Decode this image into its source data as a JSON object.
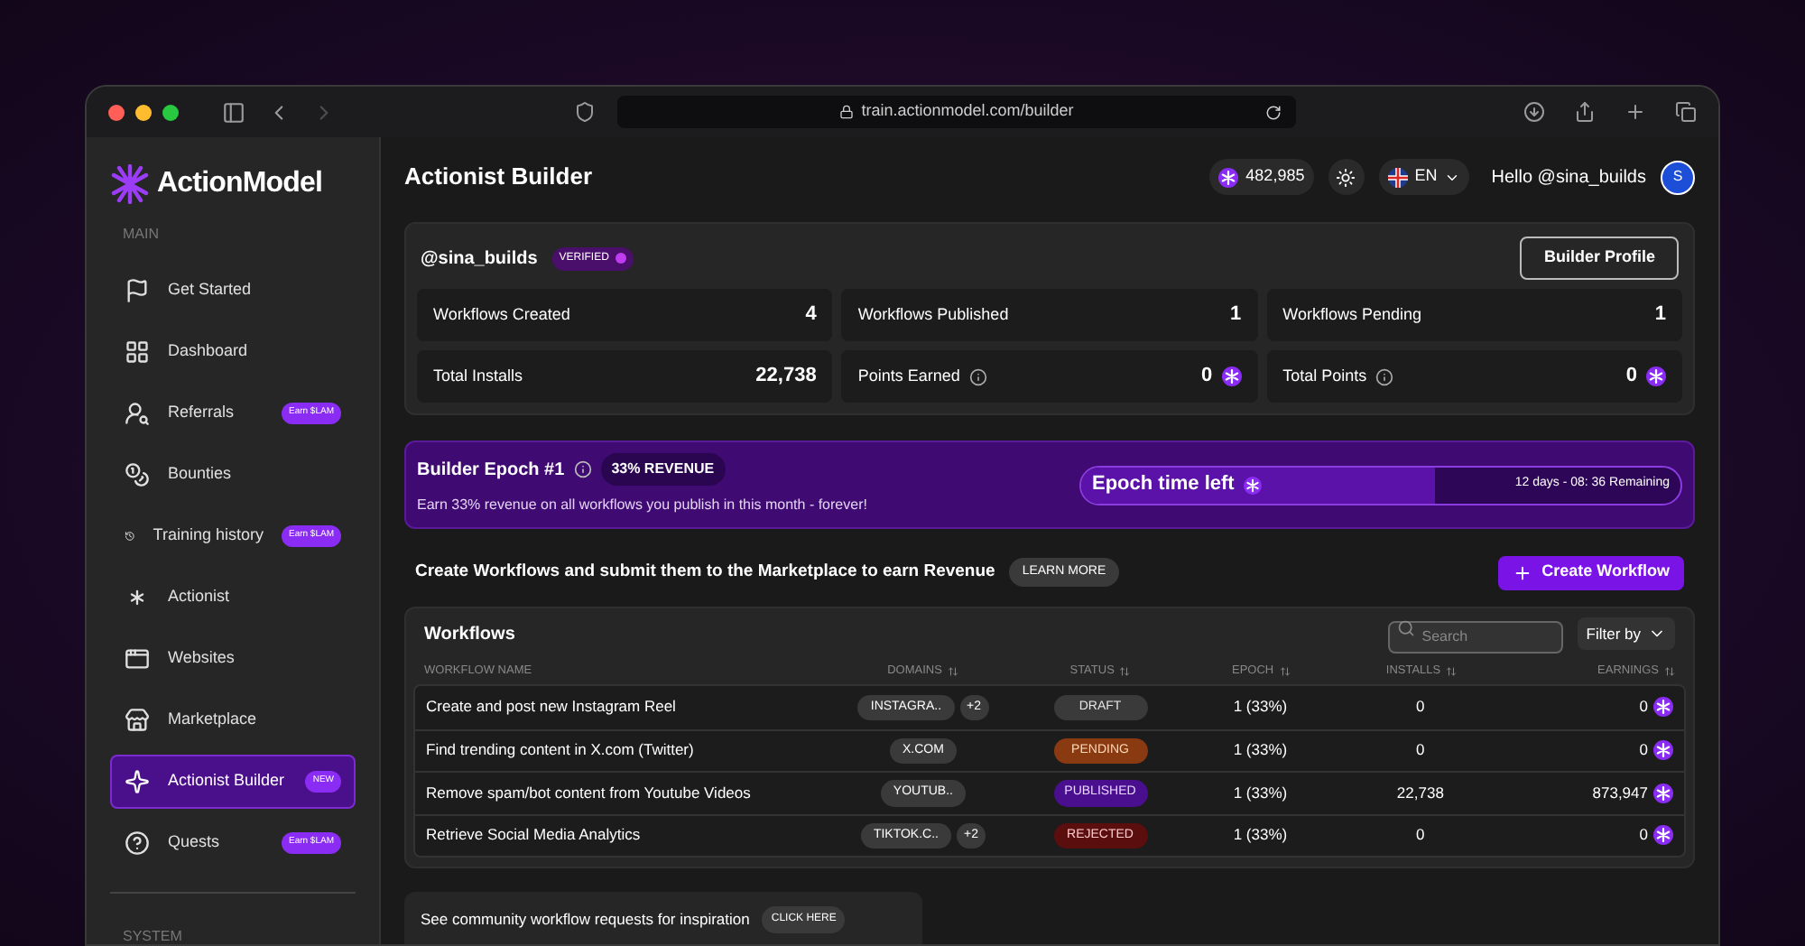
{
  "browser": {
    "url": "train.actionmodel.com/builder"
  },
  "sidebar": {
    "logo": "ActionModel",
    "section_main": "MAIN",
    "section_system": "SYSTEM",
    "items": [
      {
        "label": "Get Started",
        "selected": false
      },
      {
        "label": "Dashboard",
        "selected": false
      },
      {
        "label": "Referrals",
        "selected": false,
        "badge": "Earn $LAM"
      },
      {
        "label": "Bounties",
        "selected": false
      },
      {
        "label": "Training history",
        "selected": false,
        "badge": "Earn $LAM"
      },
      {
        "label": "Actionist",
        "selected": false
      },
      {
        "label": "Websites",
        "selected": false
      },
      {
        "label": "Marketplace",
        "selected": false
      },
      {
        "label": "Actionist Builder",
        "selected": true,
        "badge": "NEW"
      },
      {
        "label": "Quests",
        "selected": false,
        "badge": "Earn $LAM"
      }
    ]
  },
  "header": {
    "title": "Actionist Builder",
    "points": "482,985",
    "language": "EN",
    "greeting": "Hello @sina_builds",
    "avatar": "S"
  },
  "profile": {
    "handle": "@sina_builds",
    "verified_label": "VERIFIED",
    "button": "Builder Profile",
    "stats": [
      {
        "label": "Workflows Created",
        "value": "4",
        "info": false,
        "token": false
      },
      {
        "label": "Workflows Published",
        "value": "1",
        "info": false,
        "token": false
      },
      {
        "label": "Workflows Pending",
        "value": "1",
        "info": false,
        "token": false
      },
      {
        "label": "Total Installs",
        "value": "22,738",
        "info": false,
        "token": false
      },
      {
        "label": "Points Earned",
        "value": "0",
        "info": true,
        "token": true
      },
      {
        "label": "Total Points",
        "value": "0",
        "info": true,
        "token": true
      }
    ]
  },
  "epoch": {
    "title": "Builder Epoch #1",
    "revenue_badge": "33% REVENUE",
    "description": "Earn 33% revenue on all workflows you publish in this month - forever!",
    "timer_label": "Epoch time left",
    "level": 0.59,
    "remaining": "12 days - 08: 36",
    "remaining_suffix": "Remaining"
  },
  "cta": {
    "text": "Create Workflows and submit them to the Marketplace to earn Revenue",
    "learn_more": "LEARN MORE",
    "button": "Create Workflow"
  },
  "workflows": {
    "title": "Workflows",
    "search_placeholder": "Search",
    "filter": "Filter by",
    "columns": [
      "WORKFLOW NAME",
      "DOMAINS",
      "STATUS",
      "EPOCH",
      "INSTALLS",
      "EARNINGS"
    ],
    "rows": [
      {
        "name": "Create and post new Instagram Reel",
        "domain": "INSTAGRA..",
        "extra": "+2",
        "status": "DRAFT",
        "kind": "draft",
        "epoch": "1 (33%)",
        "installs": "0",
        "earnings": "0"
      },
      {
        "name": "Find trending content in X.com (Twitter)",
        "domain": "X.COM",
        "status": "PENDING",
        "kind": "pending",
        "epoch": "1 (33%)",
        "installs": "0",
        "earnings": "0"
      },
      {
        "name": "Remove spam/bot content from Youtube Videos",
        "domain": "YOUTUB..",
        "status": "PUBLISHED",
        "kind": "published",
        "epoch": "1 (33%)",
        "installs": "22,738",
        "earnings": "873,947"
      },
      {
        "name": "Retrieve Social Media Analytics",
        "domain": "TIKTOK.C..",
        "extra": "+2",
        "status": "REJECTED",
        "kind": "rejected",
        "epoch": "1 (33%)",
        "installs": "0",
        "earnings": "0"
      }
    ]
  },
  "community": {
    "text": "See community workflow requests for inspiration",
    "button": "CLICK HERE"
  }
}
